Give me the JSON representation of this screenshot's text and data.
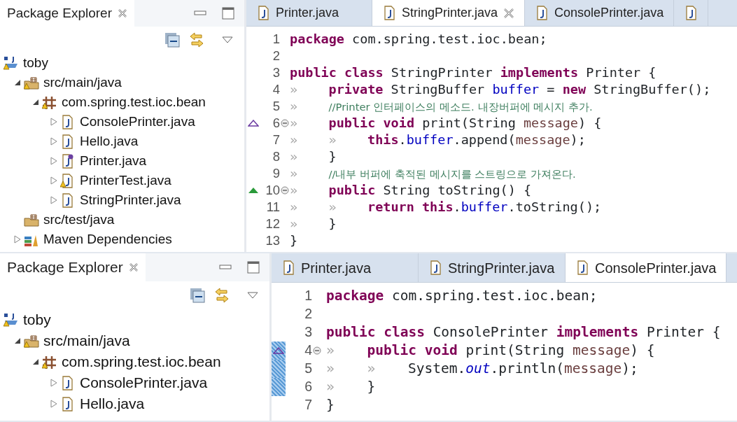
{
  "panes": [
    {
      "explorer": {
        "title": "Package Explorer",
        "tree": [
          {
            "label": "toby",
            "kind": "project",
            "warning": true,
            "children": [
              {
                "label": "src/main/java",
                "kind": "source-folder",
                "warning": true,
                "expanded": true,
                "children": [
                  {
                    "label": "com.spring.test.ioc.bean",
                    "kind": "package",
                    "warning": true,
                    "expanded": true,
                    "children": [
                      {
                        "label": "ConsolePrinter.java",
                        "kind": "java-file",
                        "warning": false,
                        "expanded": false
                      },
                      {
                        "label": "Hello.java",
                        "kind": "java-file",
                        "warning": false,
                        "expanded": false
                      },
                      {
                        "label": "Printer.java",
                        "kind": "interface-file",
                        "warning": false,
                        "expanded": false
                      },
                      {
                        "label": "PrinterTest.java",
                        "kind": "java-file",
                        "warning": true,
                        "expanded": false
                      },
                      {
                        "label": "StringPrinter.java",
                        "kind": "java-file",
                        "warning": false,
                        "expanded": false
                      }
                    ]
                  }
                ]
              },
              {
                "label": "src/test/java",
                "kind": "test-folder",
                "warning": false
              },
              {
                "label": "Maven Dependencies",
                "kind": "library",
                "warning": false,
                "expanded": false
              }
            ]
          }
        ]
      },
      "editor": {
        "tabs": [
          {
            "label": "Printer.java",
            "selected": false
          },
          {
            "label": "StringPrinter.java",
            "selected": true
          },
          {
            "label": "ConsolePrinter.java",
            "selected": false
          },
          {
            "selected": false
          }
        ],
        "lines": [
          {
            "number": "1",
            "tokens": [
              {
                "kind": "kw",
                "text": "package"
              },
              {
                "kind": "p",
                "text": " com.spring.test.ioc.bean;"
              }
            ]
          },
          {
            "number": "2"
          },
          {
            "number": "3",
            "tokens": [
              {
                "kind": "kw",
                "text": "public class"
              },
              {
                "kind": "p",
                "text": " StringPrinter "
              },
              {
                "kind": "kw",
                "text": "implements"
              },
              {
                "kind": "p",
                "text": " Printer {"
              }
            ]
          },
          {
            "number": "4",
            "tokens": [
              {
                "kind": "tab",
                "text": "»"
              },
              {
                "kind": "kw",
                "text": "private"
              },
              {
                "kind": "p",
                "text": " StringBuffer "
              },
              {
                "kind": "field",
                "text": "buffer"
              },
              {
                "kind": "p",
                "text": " = "
              },
              {
                "kind": "kw",
                "text": "new"
              },
              {
                "kind": "p",
                "text": " StringBuffer();"
              }
            ]
          },
          {
            "number": "5",
            "tokens": [
              {
                "kind": "tab",
                "text": "»"
              },
              {
                "kind": "comment",
                "text": "//Printer 인터페이스의 메소드. 내장버퍼에 메시지 추가."
              }
            ]
          },
          {
            "number": "6",
            "implements": true,
            "foldable": true,
            "tokens": [
              {
                "kind": "tab",
                "text": "»"
              },
              {
                "kind": "kw",
                "text": "public void"
              },
              {
                "kind": "p",
                "text": " print(String "
              },
              {
                "kind": "param",
                "text": "message"
              },
              {
                "kind": "p",
                "text": ") {"
              }
            ]
          },
          {
            "number": "7",
            "tokens": [
              {
                "kind": "tab",
                "text": "»"
              },
              {
                "kind": "tab",
                "text": "»"
              },
              {
                "kind": "kw",
                "text": "this"
              },
              {
                "kind": "p",
                "text": "."
              },
              {
                "kind": "field",
                "text": "buffer"
              },
              {
                "kind": "p",
                "text": ".append("
              },
              {
                "kind": "param",
                "text": "message"
              },
              {
                "kind": "p",
                "text": ");"
              }
            ]
          },
          {
            "number": "8",
            "tokens": [
              {
                "kind": "tab",
                "text": "»"
              },
              {
                "kind": "p",
                "text": "}"
              }
            ]
          },
          {
            "number": "9",
            "tokens": [
              {
                "kind": "tab",
                "text": "»"
              },
              {
                "kind": "comment",
                "text": "//내부 버퍼에 축적된 메시지를 스트링으로 가져온다."
              }
            ]
          },
          {
            "number": "10",
            "overrides": true,
            "foldable": true,
            "tokens": [
              {
                "kind": "tab",
                "text": "»"
              },
              {
                "kind": "kw",
                "text": "public"
              },
              {
                "kind": "p",
                "text": " String toString() {"
              }
            ]
          },
          {
            "number": "11",
            "tokens": [
              {
                "kind": "tab",
                "text": "»"
              },
              {
                "kind": "tab",
                "text": "»"
              },
              {
                "kind": "kw",
                "text": "return this"
              },
              {
                "kind": "p",
                "text": "."
              },
              {
                "kind": "field",
                "text": "buffer"
              },
              {
                "kind": "p",
                "text": ".toString();"
              }
            ]
          },
          {
            "number": "12",
            "tokens": [
              {
                "kind": "tab",
                "text": "»"
              },
              {
                "kind": "p",
                "text": "}"
              }
            ]
          },
          {
            "number": "13",
            "tokens": [
              {
                "kind": "p",
                "text": "}"
              }
            ]
          }
        ]
      }
    },
    {
      "explorer": {
        "title": "Package Explorer",
        "tree": [
          {
            "label": "toby",
            "kind": "project",
            "warning": true,
            "children": [
              {
                "label": "src/main/java",
                "kind": "source-folder",
                "warning": true,
                "expanded": true,
                "children": [
                  {
                    "label": "com.spring.test.ioc.bean",
                    "kind": "package",
                    "warning": true,
                    "expanded": true,
                    "children": [
                      {
                        "label": "ConsolePrinter.java",
                        "kind": "java-file",
                        "warning": false,
                        "expanded": false
                      },
                      {
                        "label": "Hello.java",
                        "kind": "java-file",
                        "warning": false,
                        "expanded": false
                      }
                    ]
                  }
                ]
              }
            ]
          }
        ]
      },
      "editor": {
        "tabs": [
          {
            "label": "Printer.java",
            "selected": false
          },
          {
            "label": "StringPrinter.java",
            "selected": false
          },
          {
            "label": "ConsolePrinter.java",
            "selected": true
          }
        ],
        "lines": [
          {
            "number": "1",
            "tokens": [
              {
                "kind": "kw",
                "text": "package"
              },
              {
                "kind": "p",
                "text": " com.spring.test.ioc.bean;"
              }
            ]
          },
          {
            "number": "2"
          },
          {
            "number": "3",
            "tokens": [
              {
                "kind": "kw",
                "text": "public class"
              },
              {
                "kind": "p",
                "text": " ConsolePrinter "
              },
              {
                "kind": "kw",
                "text": "implements"
              },
              {
                "kind": "p",
                "text": " Printer {"
              }
            ]
          },
          {
            "number": "4",
            "implements": true,
            "foldable": true,
            "highlighted": true,
            "tokens": [
              {
                "kind": "tab",
                "text": "»"
              },
              {
                "kind": "kw",
                "text": "public void"
              },
              {
                "kind": "p",
                "text": " print(String "
              },
              {
                "kind": "param",
                "text": "message"
              },
              {
                "kind": "p",
                "text": ") {"
              }
            ]
          },
          {
            "number": "5",
            "highlighted": true,
            "tokens": [
              {
                "kind": "tab",
                "text": "»"
              },
              {
                "kind": "tab",
                "text": "»"
              },
              {
                "kind": "p",
                "text": "System."
              },
              {
                "kind": "static",
                "text": "out"
              },
              {
                "kind": "p",
                "text": ".println("
              },
              {
                "kind": "param",
                "text": "message"
              },
              {
                "kind": "p",
                "text": ");"
              }
            ]
          },
          {
            "number": "6",
            "highlighted": true,
            "tokens": [
              {
                "kind": "tab",
                "text": "»"
              },
              {
                "kind": "p",
                "text": "}"
              }
            ]
          },
          {
            "number": "7",
            "tokens": [
              {
                "kind": "p",
                "text": "}"
              }
            ]
          }
        ]
      }
    }
  ]
}
